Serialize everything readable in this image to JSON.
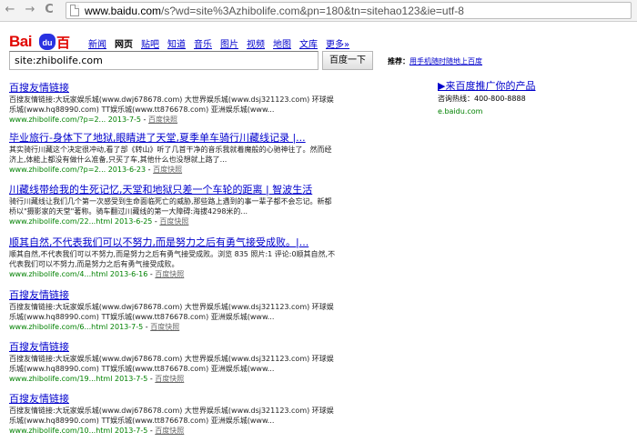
{
  "browser": {
    "url_host": "www.baidu.com",
    "url_rest": "/s?wd=site%3Azhibolife.com&pn=180&tn=sitehao123&ie=utf-8",
    "back_glyph": "←",
    "forward_glyph": "→",
    "reload_glyph": "C"
  },
  "logo": {
    "bai": "Bai",
    "paw": "du",
    "du": "百度"
  },
  "nav": {
    "items": [
      {
        "label": "新闻"
      },
      {
        "label": "网页"
      },
      {
        "label": "贴吧"
      },
      {
        "label": "知道"
      },
      {
        "label": "音乐"
      },
      {
        "label": "图片"
      },
      {
        "label": "视频"
      },
      {
        "label": "地图"
      },
      {
        "label": "文库"
      },
      {
        "label": "更多»"
      }
    ]
  },
  "search": {
    "query": "site:zhibolife.com",
    "button_label": "百度一下"
  },
  "recommend": {
    "label": "推荐：",
    "link": "用手机随时随地上百度"
  },
  "results": [
    {
      "title": "百搜友情链接",
      "snippet": "百搜友情链接:大玩家娱乐城(www.dwj678678.com) 大世界娱乐城(www.dsj321123.com) 环球娱乐城(www.hq88990.com) TT娱乐城(www.tt876678.com) 亚洲娱乐城(www...",
      "url": "www.zhibolife.com/?p=2... 2013-7-5",
      "snap": "百度快照"
    },
    {
      "title": "毕业旅行-身体下了地狱,眼睛进了天堂,夏季单车骑行川藏线记录 |...",
      "snippet": "其实骑行川藏这个决定很冲动,看了部《转山》听了几首干净的音乐我就着魔般的心驰神往了。然而经济上,体能上都没有做什么准备,只买了车,其他什么也没想就上路了...",
      "url": "www.zhibolife.com/?p=2... 2013-6-23",
      "snap": "百度快照"
    },
    {
      "title": "川藏线带给我的生死记忆,天堂和地狱只差一个车轮的距离 | 智波生活",
      "snippet": "骑行川藏线让我们几个第一次感受到生命面临死亡的威胁,那些路上遇到的事一辈子都不会忘记。新都桥以\"摄影家的天堂\"著称。骑车翻过川藏线的第一大障碍:海拔4298米的...",
      "url": "www.zhibolife.com/22...html 2013-6-25",
      "snap": "百度快照"
    },
    {
      "title": "顺其自然,不代表我们可以不努力,而是努力之后有勇气接受成败。|...",
      "snippet": "顺其自然,不代表我们可以不努力,而是努力之后有勇气接受成败。浏览 835 照片:1 评论:0顺其自然,不代表我们可以不努力,而是努力之后有勇气接受成败。",
      "url": "www.zhibolife.com/4...html 2013-6-16",
      "snap": "百度快照"
    },
    {
      "title": "百搜友情链接",
      "snippet": "百搜友情链接:大玩家娱乐城(www.dwj678678.com) 大世界娱乐城(www.dsj321123.com) 环球娱乐城(www.hq88990.com) TT娱乐城(www.tt876678.com) 亚洲娱乐城(www...",
      "url": "www.zhibolife.com/6...html 2013-7-5",
      "snap": "百度快照"
    },
    {
      "title": "百搜友情链接",
      "snippet": "百搜友情链接:大玩家娱乐城(www.dwj678678.com) 大世界娱乐城(www.dsj321123.com) 环球娱乐城(www.hq88990.com) TT娱乐城(www.tt876678.com) 亚洲娱乐城(www...",
      "url": "www.zhibolife.com/19...html 2013-7-5",
      "snap": "百度快照"
    },
    {
      "title": "百搜友情链接",
      "snippet": "百搜友情链接:大玩家娱乐城(www.dwj678678.com) 大世界娱乐城(www.dsj321123.com) 环球娱乐城(www.hq88990.com) TT娱乐城(www.tt876678.com) 亚洲娱乐城(www...",
      "url": "www.zhibolife.com/10...html 2013-7-5",
      "snap": "百度快照"
    }
  ],
  "ad": {
    "title": "▶来百度推广你的产品",
    "phone": "咨询热线：400-800-8888",
    "url": "e.baidu.com"
  }
}
